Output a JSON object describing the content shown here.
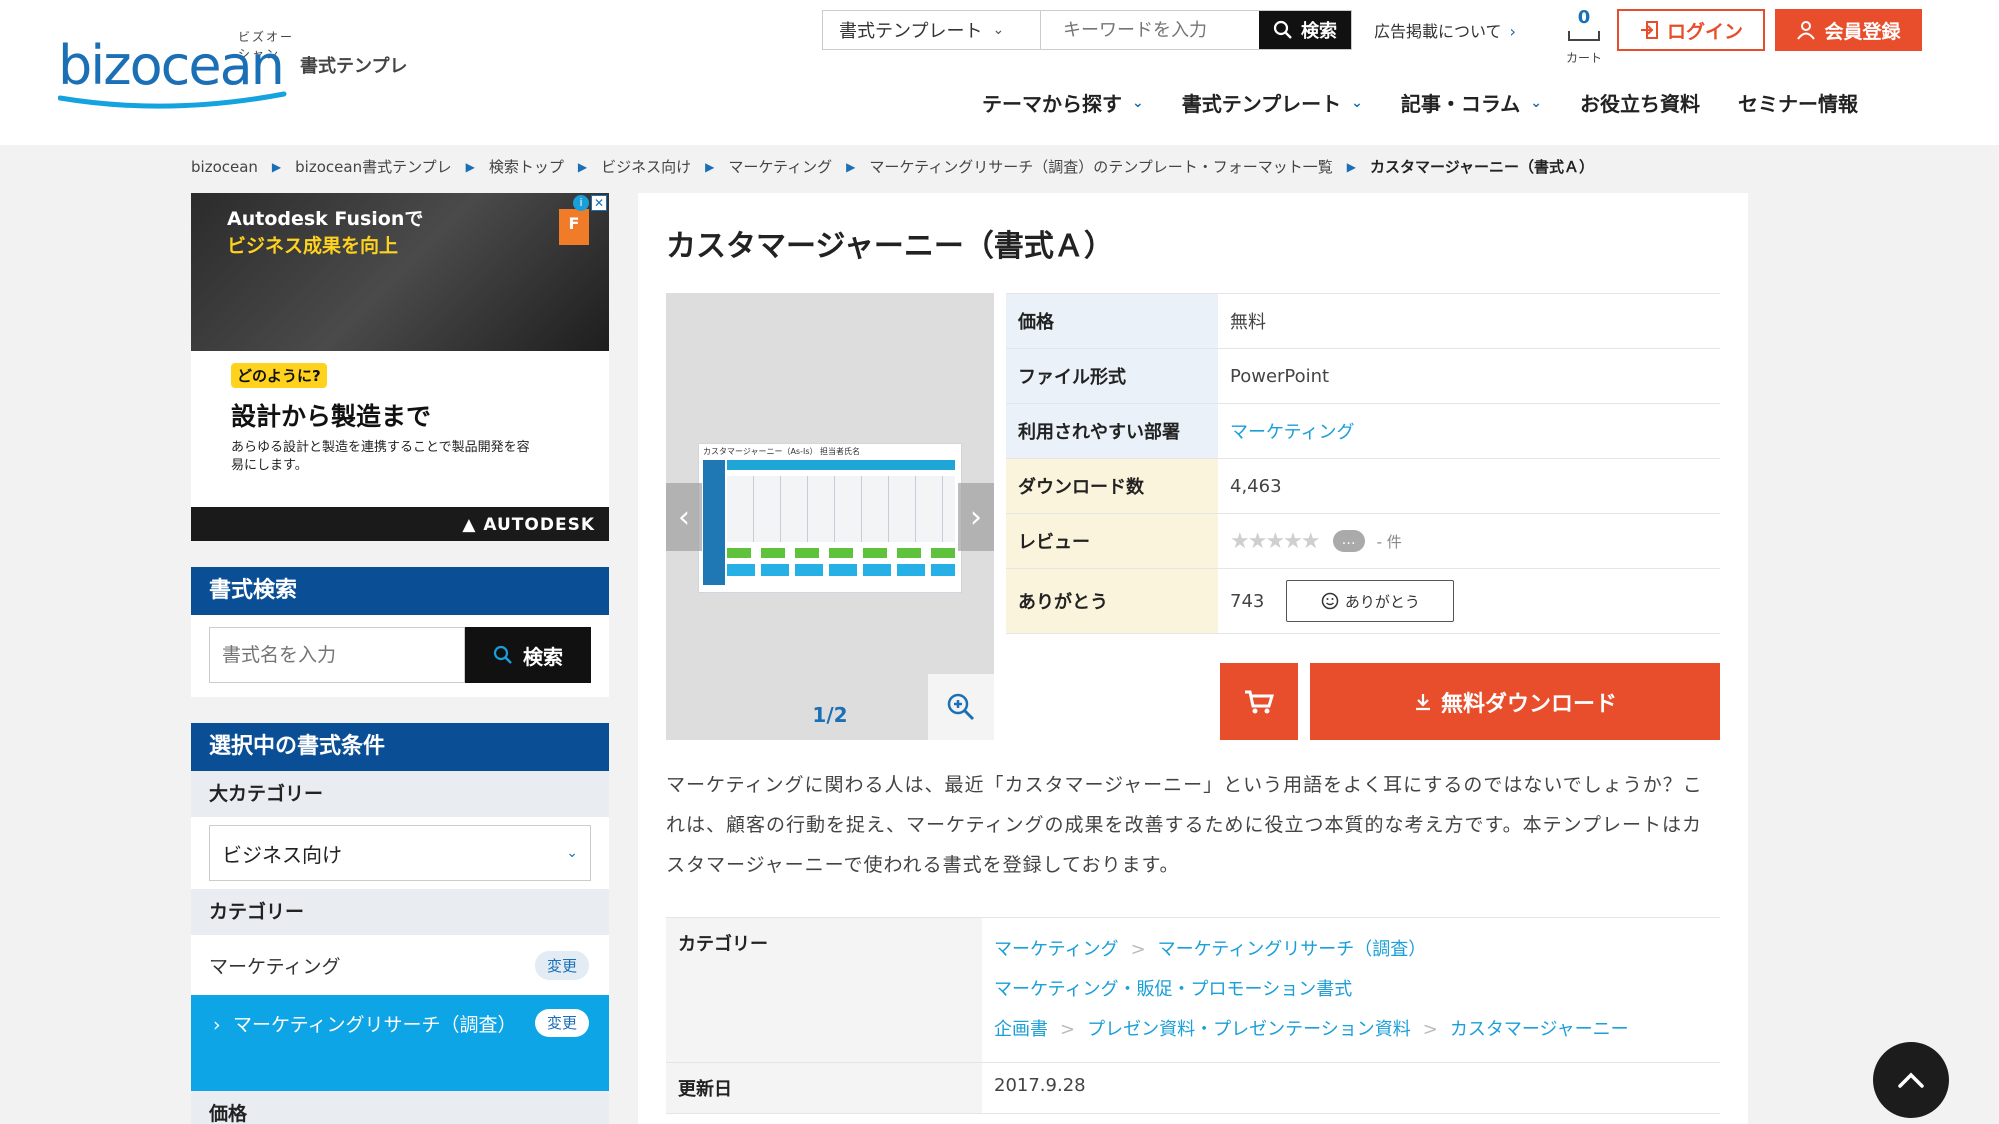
{
  "header": {
    "logo_kana": "ビズオーシャン",
    "logo_word": "bizocean",
    "logo_sub": "書式テンプレ",
    "search_category": "書式テンプレート",
    "search_placeholder": "キーワードを入力",
    "search_button": "検索",
    "ad_link": "広告掲載について",
    "cart_count": "0",
    "cart_label": "カート",
    "login": "ログイン",
    "register": "会員登録"
  },
  "nav": [
    {
      "label": "テーマから探す"
    },
    {
      "label": "書式テンプレート"
    },
    {
      "label": "記事・コラム"
    },
    {
      "label": "お役立ち資料"
    },
    {
      "label": "セミナー情報"
    }
  ],
  "breadcrumb": [
    "bizocean",
    "bizocean書式テンプレ",
    "検索トップ",
    "ビジネス向け",
    "マーケティング",
    "マーケティングリサーチ（調査）のテンプレート・フォーマット一覧",
    "カスタマージャーニー（書式Ａ）"
  ],
  "ad": {
    "headline1": "Autodesk Fusionで",
    "headline2": "ビジネス成果を向上",
    "badge": "F",
    "question": "どのように?",
    "big": "設計から製造まで",
    "small": "あらゆる設計と製造を連携することで製品開発を容易にします。",
    "brand": "AUTODESK"
  },
  "sidebar": {
    "search_title": "書式検索",
    "search_placeholder": "書式名を入力",
    "search_button": "検索",
    "cond_title": "選択中の書式条件",
    "major_head": "大カテゴリー",
    "major_value": "ビジネス向け",
    "cat_head": "カテゴリー",
    "cat_value": "マーケティング",
    "change": "変更",
    "sub_value": "マーケティングリサーチ（調査）",
    "price_head": "価格"
  },
  "main": {
    "title": "カスタマージャーニー（書式Ａ）",
    "preview_count": "1/2",
    "preview_doc_title": "カスタマージャーニー（As-Is） 担当者氏名",
    "info": [
      {
        "key": "価格",
        "value": "無料"
      },
      {
        "key": "ファイル形式",
        "value": "PowerPoint"
      },
      {
        "key": "利用されやすい部署",
        "value": "マーケティング"
      },
      {
        "key": "ダウンロード数",
        "value": "4,463"
      },
      {
        "key": "レビュー",
        "value": "- 件"
      },
      {
        "key": "ありがとう",
        "value": "743"
      }
    ],
    "review_stars": "★★★★★",
    "thanks_button": "ありがとう",
    "download_button": "無料ダウンロード",
    "description": "マーケティングに関わる人は、最近「カスタマージャーニー」という用語をよく耳にするのではないでしょうか？これは、顧客の行動を捉え、マーケティングの成果を改善するために役立つ本質的な考え方です。本テンプレートはカスタマージャーニーで使われる書式を登録しております。",
    "meta_category_label": "カテゴリー",
    "meta_categories": [
      [
        "マーケティング",
        "マーケティングリサーチ（調査）"
      ],
      [
        "マーケティング・販促・プロモーション書式"
      ],
      [
        "企画書",
        "プレゼン資料・プレゼンテーション資料",
        "カスタマージャーニー"
      ]
    ],
    "meta_updated_label": "更新日",
    "meta_updated": "2017.9.28"
  },
  "colors": {
    "brand_blue": "#0a4f96",
    "accent_orange": "#e84e2c",
    "link_cyan": "#1a9fd8"
  }
}
